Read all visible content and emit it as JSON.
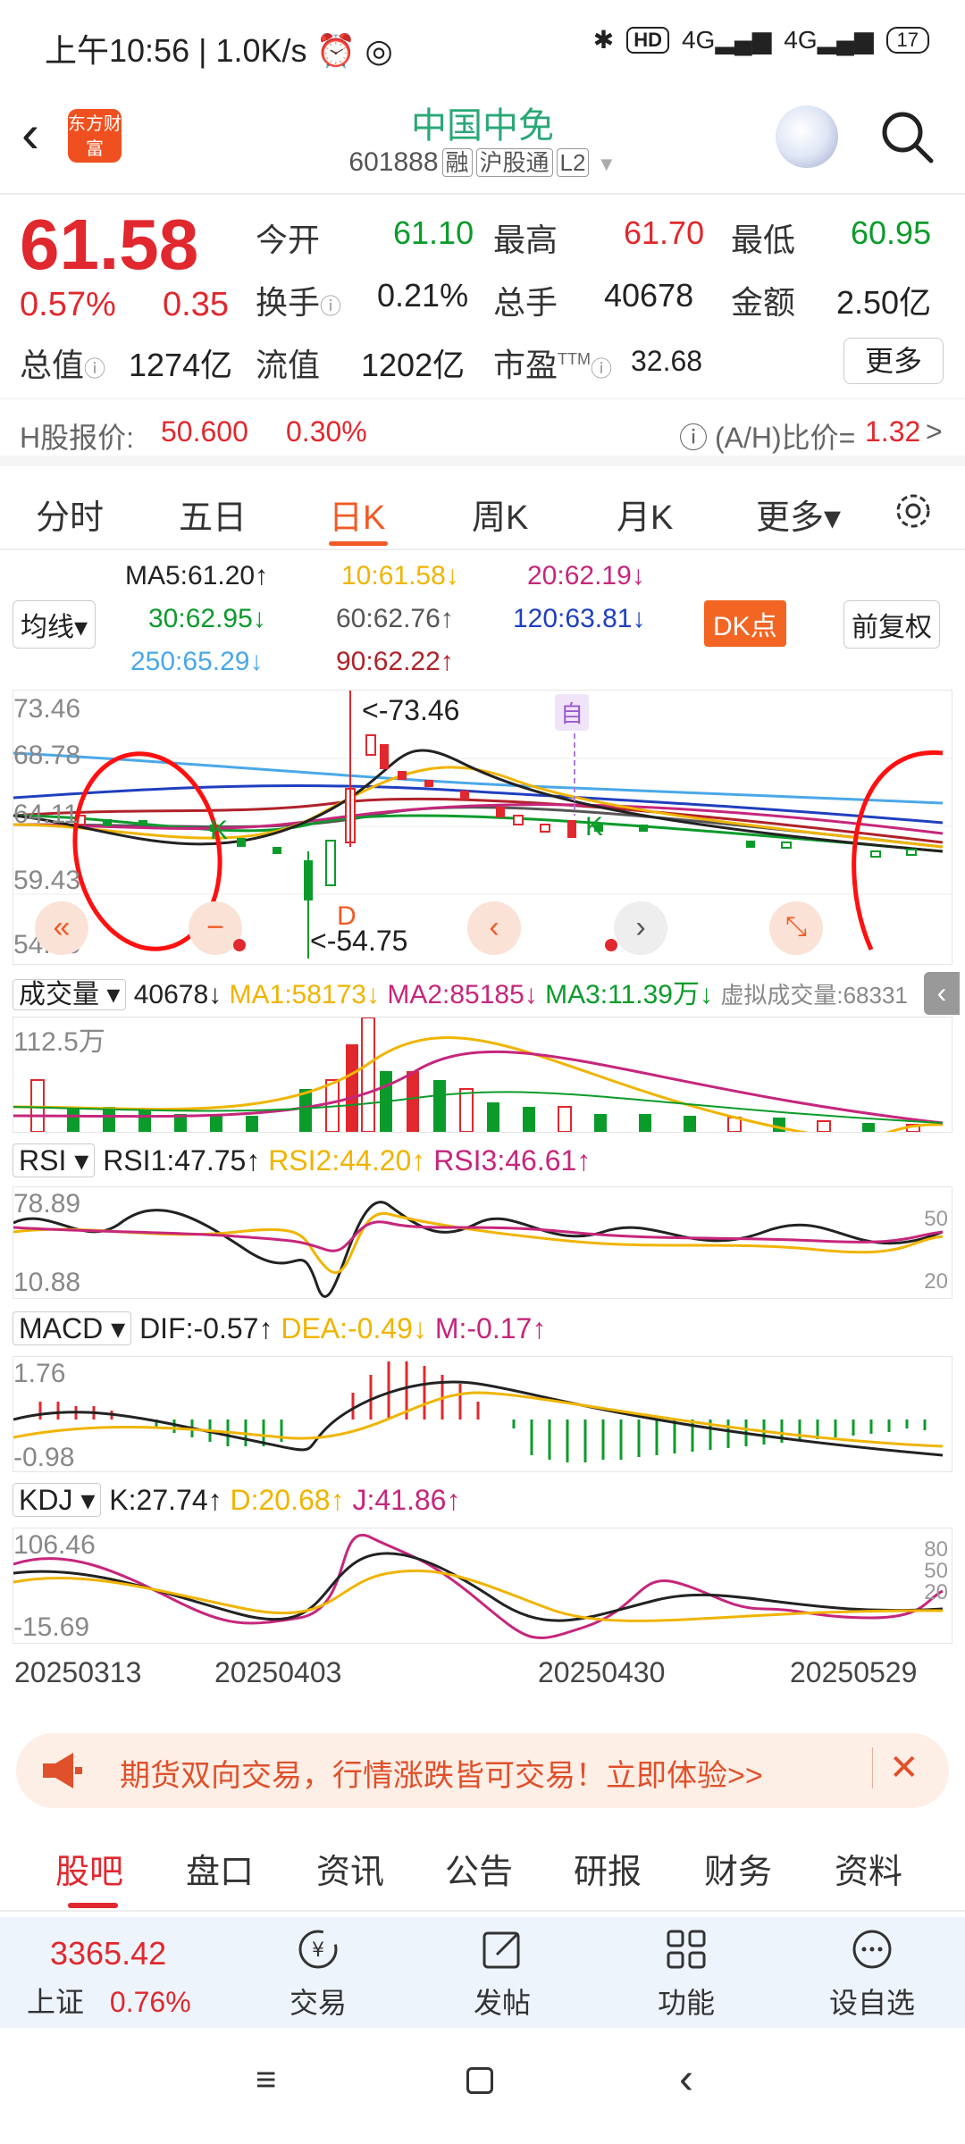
{
  "status": {
    "time": "上午10:56",
    "net_speed": "1.0K/s",
    "hd": "HD",
    "sig1": "4G",
    "sig2": "4G",
    "battery": "17"
  },
  "header": {
    "logo": "东方财富",
    "title": "中国中免",
    "code": "601888",
    "tag1": "融",
    "tag2": "沪股通",
    "tag3": "L2"
  },
  "quote": {
    "price": "61.58",
    "change_pct": "0.57%",
    "change": "0.35",
    "open_label": "今开",
    "open": "61.10",
    "high_label": "最高",
    "high": "61.70",
    "low_label": "最低",
    "low": "60.95",
    "turnover_label": "换手",
    "turnover": "0.21%",
    "volume_label": "总手",
    "volume": "40678",
    "amount_label": "金额",
    "amount": "2.50亿",
    "mktcap_label": "总值",
    "mktcap": "1274亿",
    "float_label": "流值",
    "float": "1202亿",
    "pe_label": "市盈",
    "pe_sup": "TTM",
    "pe": "32.68",
    "more": "更多"
  },
  "hshare": {
    "label": "H股报价:",
    "price": "50.600",
    "pct": "0.30%",
    "ratio_label": "(A/H)比价=",
    "ratio": "1.32",
    "arrow": ">"
  },
  "tabs": [
    "分时",
    "五日",
    "日K",
    "周K",
    "月K",
    "更多▾"
  ],
  "ma": {
    "ma5": "MA5:61.20↑",
    "ma10": "10:61.58↓",
    "ma20": "20:62.19↓",
    "selector": "均线▾",
    "ma30": "30:62.95↓",
    "ma60": "60:62.76↑",
    "ma120": "120:63.81↓",
    "dk": "DK点",
    "fq": "前复权",
    "ma250": "250:65.29↓",
    "ma90": "90:62.22↑"
  },
  "kchart": {
    "y_labels": [
      "73.46",
      "68.78",
      "64.11",
      "59.43",
      "54.75"
    ],
    "high_mark": "<-73.46",
    "low_mark": "<-54.75",
    "self_mark": "自",
    "k1": "K",
    "k2": "K",
    "d_mark": "D"
  },
  "volume": {
    "selector": "成交量",
    "vol": "40678↓",
    "ma1": "MA1:58173↓",
    "ma2": "MA2:85185↓",
    "ma3": "MA3:11.39万↓",
    "virtual": "虚拟成交量:68331",
    "ymax": "112.5万"
  },
  "rsi": {
    "selector": "RSI",
    "rsi1": "RSI1:47.75↑",
    "rsi2": "RSI2:44.20↑",
    "rsi3": "RSI3:46.61↑",
    "ymax": "78.89",
    "ymin": "10.88",
    "r50": "50",
    "r20": "20"
  },
  "macd": {
    "selector": "MACD",
    "dif": "DIF:-0.57↑",
    "dea": "DEA:-0.49↓",
    "m": "M:-0.17↑",
    "ymax": "1.76",
    "ymin": "-0.98"
  },
  "kdj": {
    "selector": "KDJ",
    "k": "K:27.74↑",
    "d": "D:20.68↑",
    "j": "J:41.86↑",
    "ymax": "106.46",
    "ymin": "-15.69",
    "r80": "80",
    "r50": "50",
    "r20": "20"
  },
  "dates": [
    "20250313",
    "20250403",
    "20250430",
    "20250529"
  ],
  "promo": {
    "text": "期货双向交易，行情涨跌皆可交易！立即体验>>"
  },
  "bottom_tabs": [
    "股吧",
    "盘口",
    "资讯",
    "公告",
    "研报",
    "财务",
    "资料"
  ],
  "bottom_nav": {
    "index_value": "3365.42",
    "index_name": "上证",
    "index_pct": "0.76%",
    "trade": "交易",
    "post": "发帖",
    "func": "功能",
    "watch": "设自选"
  },
  "colors": {
    "up": "#e0282e",
    "down": "#0b9b2b",
    "accent": "#f15a24"
  }
}
